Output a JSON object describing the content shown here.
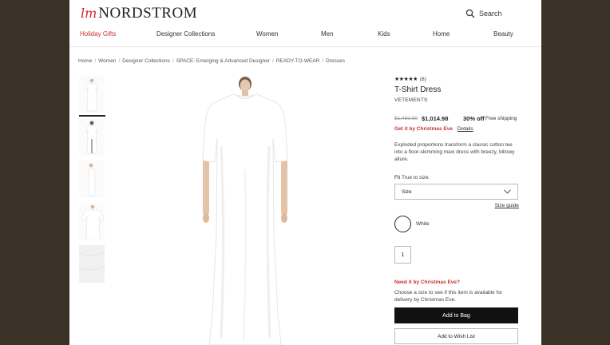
{
  "brand": {
    "mark": "lm",
    "name": "NORDSTROM"
  },
  "search": {
    "label": "Search"
  },
  "nav": [
    "Holiday Gifts",
    "Designer Collections",
    "Women",
    "Men",
    "Kids",
    "Home",
    "Beauty"
  ],
  "breadcrumb": [
    "Home",
    "Women",
    "Designer Collections",
    "SPACE: Emerging & Advanced Designer",
    "READY-TO-WEAR",
    "Dresses"
  ],
  "product": {
    "rating_stars": "★★★★★",
    "rating_count": "(8)",
    "title": "T-Shirt Dress",
    "brand": "VETEMENTS",
    "price_original": "$1,450.00",
    "price_sale": "$1,014.98",
    "discount": "30% off",
    "shipping": "Free shipping",
    "christmas": "Get it by Christmas Eve",
    "details_link": "Details",
    "description": "Exploded proportions transform a classic cotton tee into a floor-skimming maxi dress with breezy, billowy allure.",
    "fit_label": "Fit",
    "fit_value": "True to size.",
    "size_placeholder": "Size",
    "size_guide": "Size guide",
    "color": "White",
    "quantity": "1",
    "need_it": "Need it by Christmas Eve?",
    "need_it_desc": "Choose a size to see if this item is available for delivery by Christmas Eve.",
    "add_to_bag": "Add to Bag",
    "add_to_wishlist": "Add to Wish List"
  },
  "colors": {
    "accent": "#c8322f",
    "page_bg": "#3a3127",
    "button": "#111111"
  }
}
